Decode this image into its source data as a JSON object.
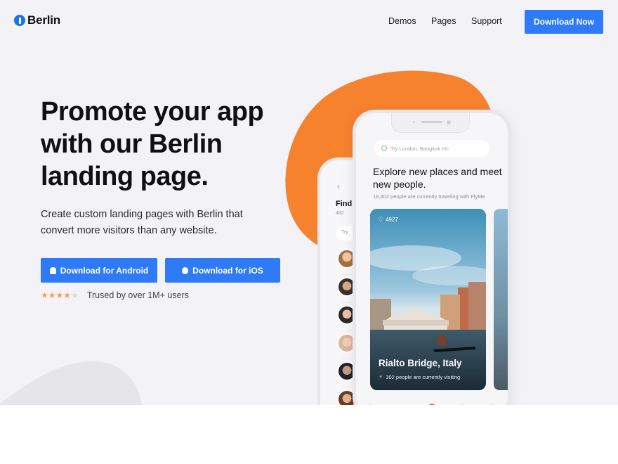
{
  "brand": {
    "name": "Berlin",
    "accent": "#2f7af6",
    "orange": "#f6822e"
  },
  "nav": {
    "items": [
      "Demos",
      "Pages",
      "Support"
    ],
    "cta": "Download Now"
  },
  "hero": {
    "headline": "Promote your app with our Berlin landing page.",
    "subtitle": "Create custom landing pages with Berlin that convert more visitors than any website.",
    "android_button": "Download for Android",
    "ios_button": "Download for iOS",
    "rating": {
      "value": 4,
      "max": 5
    },
    "trust": "Trused by over 1M+ users"
  },
  "phone_back": {
    "title": "Find",
    "count": "482",
    "search": "Try"
  },
  "phone_front": {
    "search_placeholder": "Try London, Bangkok etc",
    "headline": "Explore new places and meet new people.",
    "count_text": "18,402 people are currently traveling with FlyMe",
    "card": {
      "likes": "4927",
      "place": "Rialto Bridge, Italy",
      "visiting": "302 people are currently visiting"
    },
    "tab_badge": "1"
  }
}
